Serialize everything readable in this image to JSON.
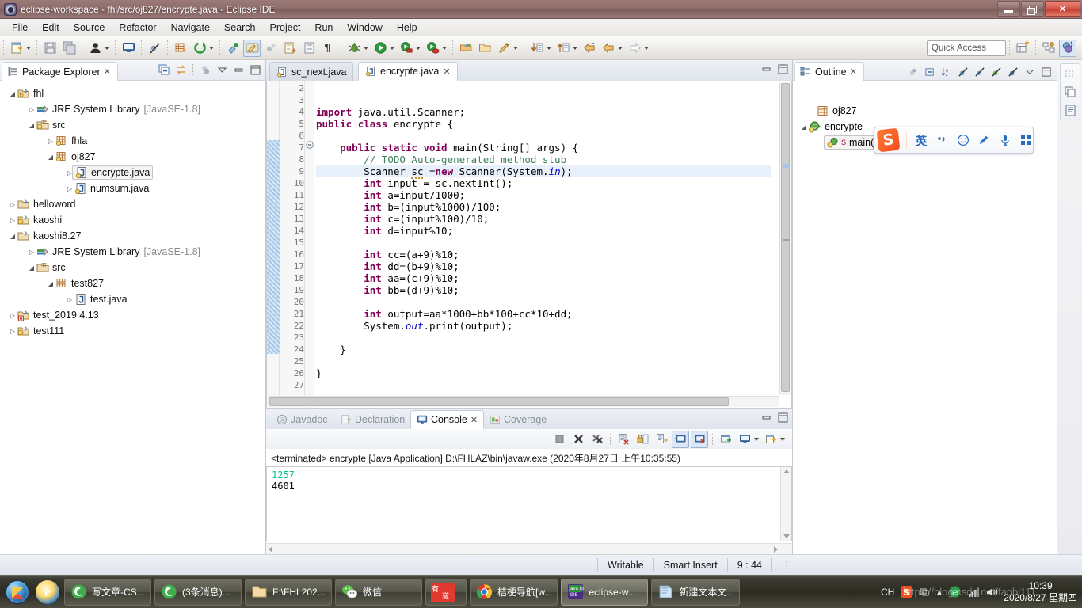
{
  "window": {
    "title": "eclipse-workspace - fhl/src/oj827/encrypte.java - Eclipse IDE",
    "app_icon": "eclipse-icon",
    "minimize": "minimize-button",
    "restore": "restore-button",
    "close": "close-button"
  },
  "menubar": {
    "items": [
      "File",
      "Edit",
      "Source",
      "Refactor",
      "Navigate",
      "Search",
      "Project",
      "Run",
      "Window",
      "Help"
    ]
  },
  "toolbar": {
    "quick_access_placeholder": "Quick Access",
    "icons": [
      "new-wizard-icon",
      "save-icon",
      "save-all-icon",
      "user-icon",
      "console-icon",
      "skip-breakpoints-icon",
      "new-java-package-icon",
      "refresh-icon",
      "external-tools-icon",
      "toggle-markoccurrences-icon",
      "annotation-icon",
      "next-annotation-icon",
      "open-type-icon",
      "show-whitespace-icon",
      "debug-icon",
      "run-icon",
      "run-last-tool-icon",
      "coverage-icon",
      "open-task-icon",
      "open-folder-icon",
      "pencil-icon",
      "next-edit-icon",
      "previous-edit-icon",
      "back-icon",
      "forward-icon",
      "perspective-icon",
      "java-browsing-icon",
      "java-perspective-icon"
    ]
  },
  "package_explorer": {
    "title": "Package Explorer",
    "close_icon": "close-view-icon",
    "tools": [
      "collapse-all-icon",
      "link-with-editor-icon",
      "view-menu-icon",
      "minimize-icon",
      "maximize-icon"
    ],
    "tree": [
      {
        "label": "fhl",
        "indent": 0,
        "icon": "java-project-icon",
        "state": "expanded"
      },
      {
        "label": "JRE System Library",
        "suffix": "[JavaSE-1.8]",
        "indent": 1,
        "icon": "library-icon",
        "state": "collapsed"
      },
      {
        "label": "src",
        "indent": 1,
        "icon": "source-folder-icon",
        "state": "expanded"
      },
      {
        "label": "fhla",
        "indent": 2,
        "icon": "package-icon",
        "state": "collapsed"
      },
      {
        "label": "oj827",
        "indent": 2,
        "icon": "package-icon",
        "state": "expanded"
      },
      {
        "label": "encrypte.java",
        "indent": 3,
        "icon": "java-file-icon",
        "state": "collapsed",
        "selected": true
      },
      {
        "label": "numsum.java",
        "indent": 3,
        "icon": "java-file-icon",
        "state": "collapsed"
      },
      {
        "label": "helloword",
        "indent": 0,
        "icon": "java-project-icon",
        "state": "collapsed"
      },
      {
        "label": "kaoshi",
        "indent": 0,
        "icon": "java-project-icon",
        "state": "collapsed"
      },
      {
        "label": "kaoshi8.27",
        "indent": 0,
        "icon": "java-project-icon",
        "state": "expanded"
      },
      {
        "label": "JRE System Library",
        "suffix": "[JavaSE-1.8]",
        "indent": 1,
        "icon": "library-icon",
        "state": "collapsed"
      },
      {
        "label": "src",
        "indent": 1,
        "icon": "source-folder-icon",
        "state": "expanded"
      },
      {
        "label": "test827",
        "indent": 2,
        "icon": "package-icon",
        "state": "expanded"
      },
      {
        "label": "test.java",
        "indent": 3,
        "icon": "java-file-icon",
        "state": "collapsed"
      },
      {
        "label": "test_2019.4.13",
        "indent": 0,
        "icon": "java-project-error-icon",
        "state": "collapsed"
      },
      {
        "label": "test111",
        "indent": 0,
        "icon": "java-project-icon",
        "state": "collapsed"
      }
    ]
  },
  "editor": {
    "tabs": [
      {
        "label": "sc_next.java",
        "active": false,
        "icon": "java-file-icon"
      },
      {
        "label": "encrypte.java",
        "active": true,
        "icon": "java-file-icon",
        "close_icon": "close-tab-icon"
      }
    ],
    "minimize_icon": "minimize-icon",
    "maximize_icon": "maximize-icon",
    "first_line": 2,
    "lines": [
      {
        "n": 2,
        "text": ""
      },
      {
        "n": 3,
        "text": ""
      },
      {
        "n": 4,
        "text": "import java.util.Scanner;"
      },
      {
        "n": 5,
        "text": "public class encrypte {"
      },
      {
        "n": 6,
        "text": ""
      },
      {
        "n": 7,
        "text": "    public static void main(String[] args) {",
        "folding": true
      },
      {
        "n": 8,
        "text": "        // TODO Auto-generated method stub"
      },
      {
        "n": 9,
        "text": "        Scanner sc =new Scanner(System.in);",
        "highlight": true
      },
      {
        "n": 10,
        "text": "        int input = sc.nextInt();"
      },
      {
        "n": 11,
        "text": "        int a=input/1000;"
      },
      {
        "n": 12,
        "text": "        int b=(input%1000)/100;"
      },
      {
        "n": 13,
        "text": "        int c=(input%100)/10;"
      },
      {
        "n": 14,
        "text": "        int d=input%10;"
      },
      {
        "n": 15,
        "text": ""
      },
      {
        "n": 16,
        "text": "        int cc=(a+9)%10;"
      },
      {
        "n": 17,
        "text": "        int dd=(b+9)%10;"
      },
      {
        "n": 18,
        "text": "        int aa=(c+9)%10;"
      },
      {
        "n": 19,
        "text": "        int bb=(d+9)%10;"
      },
      {
        "n": 20,
        "text": ""
      },
      {
        "n": 21,
        "text": "        int output=aa*1000+bb*100+cc*10+dd;"
      },
      {
        "n": 22,
        "text": "        System.out.print(output);"
      },
      {
        "n": 23,
        "text": ""
      },
      {
        "n": 24,
        "text": "    }"
      },
      {
        "n": 25,
        "text": ""
      },
      {
        "n": 26,
        "text": "}"
      },
      {
        "n": 27,
        "text": ""
      }
    ]
  },
  "console": {
    "tabs": [
      {
        "label": "Javadoc",
        "active": false,
        "icon": "javadoc-icon"
      },
      {
        "label": "Declaration",
        "active": false,
        "icon": "declaration-icon"
      },
      {
        "label": "Console",
        "active": true,
        "icon": "console-icon",
        "close_icon": "close-tab-icon"
      },
      {
        "label": "Coverage",
        "active": false,
        "icon": "coverage-icon"
      }
    ],
    "tools": [
      "terminate-icon",
      "remove-launch-icon",
      "remove-all-terminated-icon",
      "clear-console-icon",
      "scroll-lock-icon",
      "word-wrap-icon",
      "show-console-on-output-icon",
      "show-console-on-error-icon",
      "pin-console-icon",
      "display-selected-console-icon",
      "open-console-icon"
    ],
    "header": "<terminated> encrypte [Java Application] D:\\FHLAZ\\bin\\javaw.exe (2020年8月27日 上午10:35:55)",
    "output": [
      {
        "text": "1257",
        "kind": "input"
      },
      {
        "text": "4601",
        "kind": "output"
      }
    ],
    "minimize_icon": "minimize-icon",
    "maximize_icon": "maximize-icon"
  },
  "outline": {
    "title": "Outline",
    "close_icon": "close-view-icon",
    "tools": [
      "sort-icon",
      "hide-fields-icon",
      "hide-static-icon",
      "hide-nonpublic-icon",
      "view-menu-icon",
      "maximize-icon"
    ],
    "tree": [
      {
        "label": "oj827",
        "indent": 1,
        "icon": "package-icon",
        "state": "leaf"
      },
      {
        "label": "encrypte",
        "indent": 0,
        "icon": "class-icon",
        "state": "expanded"
      },
      {
        "label": "main(String[]) : void",
        "indent": 2,
        "icon": "method-icon",
        "state": "leaf",
        "selected": true,
        "modifier": "S"
      }
    ]
  },
  "minimized_views": {
    "items": [
      "restore-icon",
      "package-explorer-icon",
      "outline-icon"
    ]
  },
  "ime": {
    "logo": "sogou-logo",
    "mode": "英",
    "buttons": [
      "punctuation-icon",
      "emoji-icon",
      "pen-icon",
      "microphone-icon",
      "toolbox-icon"
    ]
  },
  "statusbar": {
    "writable": "Writable",
    "insert_mode": "Smart Insert",
    "position": "9 : 44"
  },
  "taskbar": {
    "start": "start-orb-icon",
    "quicklaunch": [
      {
        "icon": "internet-explorer-icon"
      }
    ],
    "items": [
      {
        "label": "写文章-CS...",
        "icon": "browser-360-icon"
      },
      {
        "label": "(3条消息)...",
        "icon": "browser-360-icon"
      },
      {
        "label": "F:\\FHL202...",
        "icon": "folder-icon"
      },
      {
        "label": "微信",
        "icon": "wechat-icon"
      },
      {
        "label": "",
        "icon": "youdao-icon"
      },
      {
        "label": "桔梗导航[w...",
        "icon": "chrome-icon"
      },
      {
        "label": "eclipse-w...",
        "icon": "eclipse-icon",
        "active": true
      },
      {
        "label": "新建文本文...",
        "icon": "notepad-icon"
      }
    ],
    "tray": {
      "language": "CH",
      "sogou": "sogou-tray-icon",
      "network": "network-icon",
      "show_hidden": "show-hidden-icon",
      "ie": "ie-tray-icon",
      "volume": "volume-icon"
    },
    "clock_time": "10:39",
    "clock_date": "2020/8/27 星期四"
  },
  "watermark": "https://blog.csdn.net/fanbl111",
  "colors": {
    "title_bar": "#8e6d6b",
    "accent_blue": "#2a6bbd",
    "keyword": "#7f0055",
    "comment": "#3f7f5f",
    "field": "#0000c0",
    "console_input": "#0ac18e",
    "highlight_line": "#e8f0fb"
  }
}
